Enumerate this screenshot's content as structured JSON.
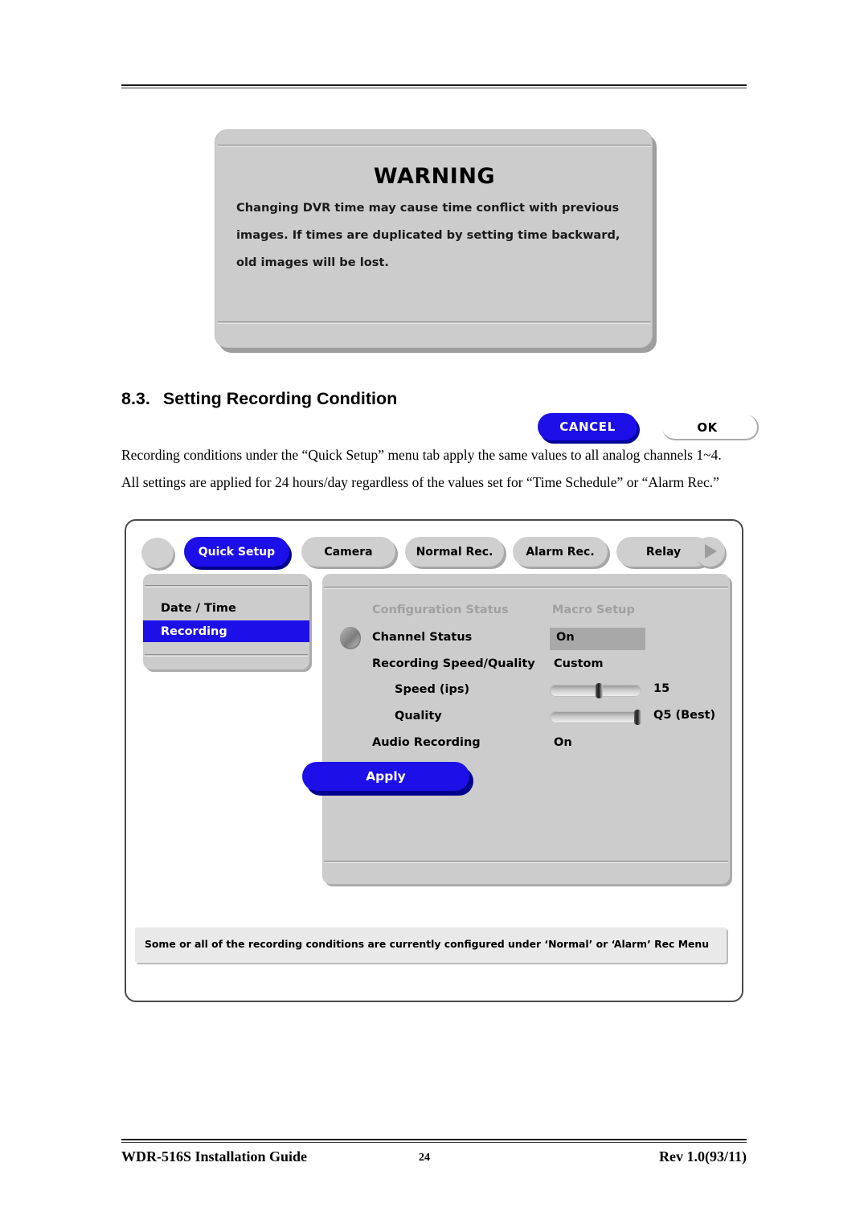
{
  "warning_dialog": {
    "title": "WARNING",
    "lines": [
      "Changing DVR time may cause time conflict with previous",
      "images. If times are duplicated by setting time backward,",
      "old images will be lost."
    ],
    "cancel_label": "CANCEL",
    "ok_label": "OK",
    "accent_color": "#1d0fe8",
    "panel_color": "#cccccc"
  },
  "section": {
    "number": "8.3.",
    "title": "Setting Recording Condition",
    "paragraph_1": "Recording conditions under the “Quick Setup” menu tab apply the same values to all analog channels 1~4.",
    "paragraph_2": "All settings are applied for 24 hours/day regardless of the values set for “Time Schedule” or “Alarm Rec.”"
  },
  "dvr": {
    "tabs": [
      {
        "label": "Quick Setup",
        "active": true
      },
      {
        "label": "Camera",
        "active": false
      },
      {
        "label": "Normal Rec.",
        "active": false
      },
      {
        "label": "Alarm Rec.",
        "active": false
      },
      {
        "label": "Relay",
        "active": false
      }
    ],
    "next_arrow_icon": "play-triangle-icon",
    "menu": {
      "items": [
        {
          "label": "Date / Time",
          "selected": false
        },
        {
          "label": "Recording",
          "selected": true
        }
      ]
    },
    "config": {
      "column_headers": [
        "Configuration Status",
        "Macro Setup"
      ],
      "rows": [
        {
          "label": "Channel Status",
          "value": "On",
          "type": "macro-box"
        },
        {
          "label": "Recording Speed/Quality",
          "value": "Custom",
          "type": "text"
        },
        {
          "label": "Speed (ips)",
          "value": "15",
          "type": "slider",
          "percent": 52
        },
        {
          "label": "Quality",
          "value": "Q5 (Best)",
          "type": "slider",
          "percent": 100
        },
        {
          "label": "Audio Recording",
          "value": "On",
          "type": "text"
        }
      ],
      "apply_label": "Apply"
    },
    "status_message": "Some or all of the recording conditions are currently configured under ‘Normal’ or ‘Alarm’ Rec Menu"
  },
  "footer": {
    "left": "WDR-516S  Installation  Guide",
    "page_number": "24",
    "right": "Rev  1.0(93/11)"
  }
}
